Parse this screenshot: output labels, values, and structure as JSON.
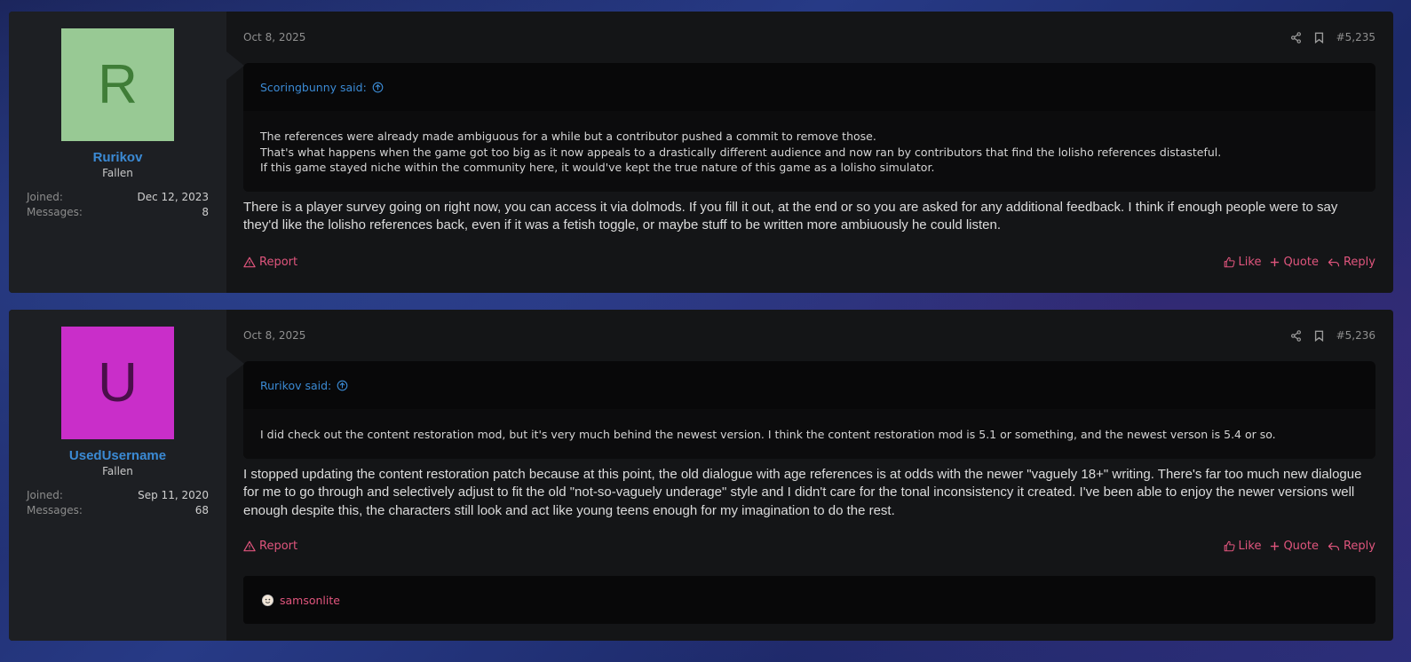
{
  "posts": [
    {
      "avatar_letter": "R",
      "avatar_bg": "#98c994",
      "avatar_fg": "#3f7d37",
      "username": "Rurikov",
      "user_title": "Fallen",
      "joined_label": "Joined:",
      "joined": "Dec 12, 2023",
      "messages_label": "Messages:",
      "messages": "8",
      "date": "Oct 8, 2025",
      "post_number": "#5,235",
      "quote_author": "Scoringbunny said:",
      "quote_lines": [
        "The references were already made ambiguous for a while but a contributor pushed a commit to remove those.",
        "That's what happens when the game got too big as it now appeals to a drastically different audience and now ran by contributors that find the lolisho references distasteful.",
        "If this game stayed niche within the community here, it would've kept the true nature of this game as a lolisho simulator."
      ],
      "message": "There is a player survey going on right now, you can access it via dolmods. If you fill it out, at the end or so you are asked for any additional feedback. I think if enough people were to say they'd like the lolisho references back, even if it was a fetish toggle, or maybe stuff to be written more ambiuously he could listen.",
      "report": "Report",
      "like": "Like",
      "quote": "Quote",
      "reply": "Reply"
    },
    {
      "avatar_letter": "U",
      "avatar_bg": "#c92ec9",
      "avatar_fg": "#4a0f4a",
      "username": "UsedUsername",
      "user_title": "Fallen",
      "joined_label": "Joined:",
      "joined": "Sep 11, 2020",
      "messages_label": "Messages:",
      "messages": "68",
      "date": "Oct 8, 2025",
      "post_number": "#5,236",
      "quote_author": "Rurikov said:",
      "quote_lines": [
        "I did check out the content restoration mod, but it's very much behind the newest version. I think the content restoration mod is 5.1 or something, and the newest verson is 5.4 or so."
      ],
      "message": "I stopped updating the content restoration patch because at this point, the old dialogue with age references is at odds with the newer \"vaguely 18+\" writing. There's far too much new dialogue for me to go through and selectively adjust to fit the old \"not-so-vaguely underage\" style and I didn't care for the tonal inconsistency it created. I've been able to enjoy the newer versions well enough despite this, the characters still look and act like young teens enough for my imagination to do the rest.",
      "report": "Report",
      "like": "Like",
      "quote": "Quote",
      "reply": "Reply",
      "reaction_user": "samsonlite"
    }
  ],
  "icons": {
    "share": "share-icon",
    "bookmark": "bookmark-icon",
    "goto": "arrow-up-circle-icon",
    "report": "warning-triangle-icon",
    "like": "thumbs-up-icon",
    "quote": "plus-icon",
    "reply": "reply-arrow-icon",
    "reaction": "reaction-face-icon"
  },
  "colors": {
    "accent": "#e0557d",
    "link": "#3b8ad4"
  }
}
